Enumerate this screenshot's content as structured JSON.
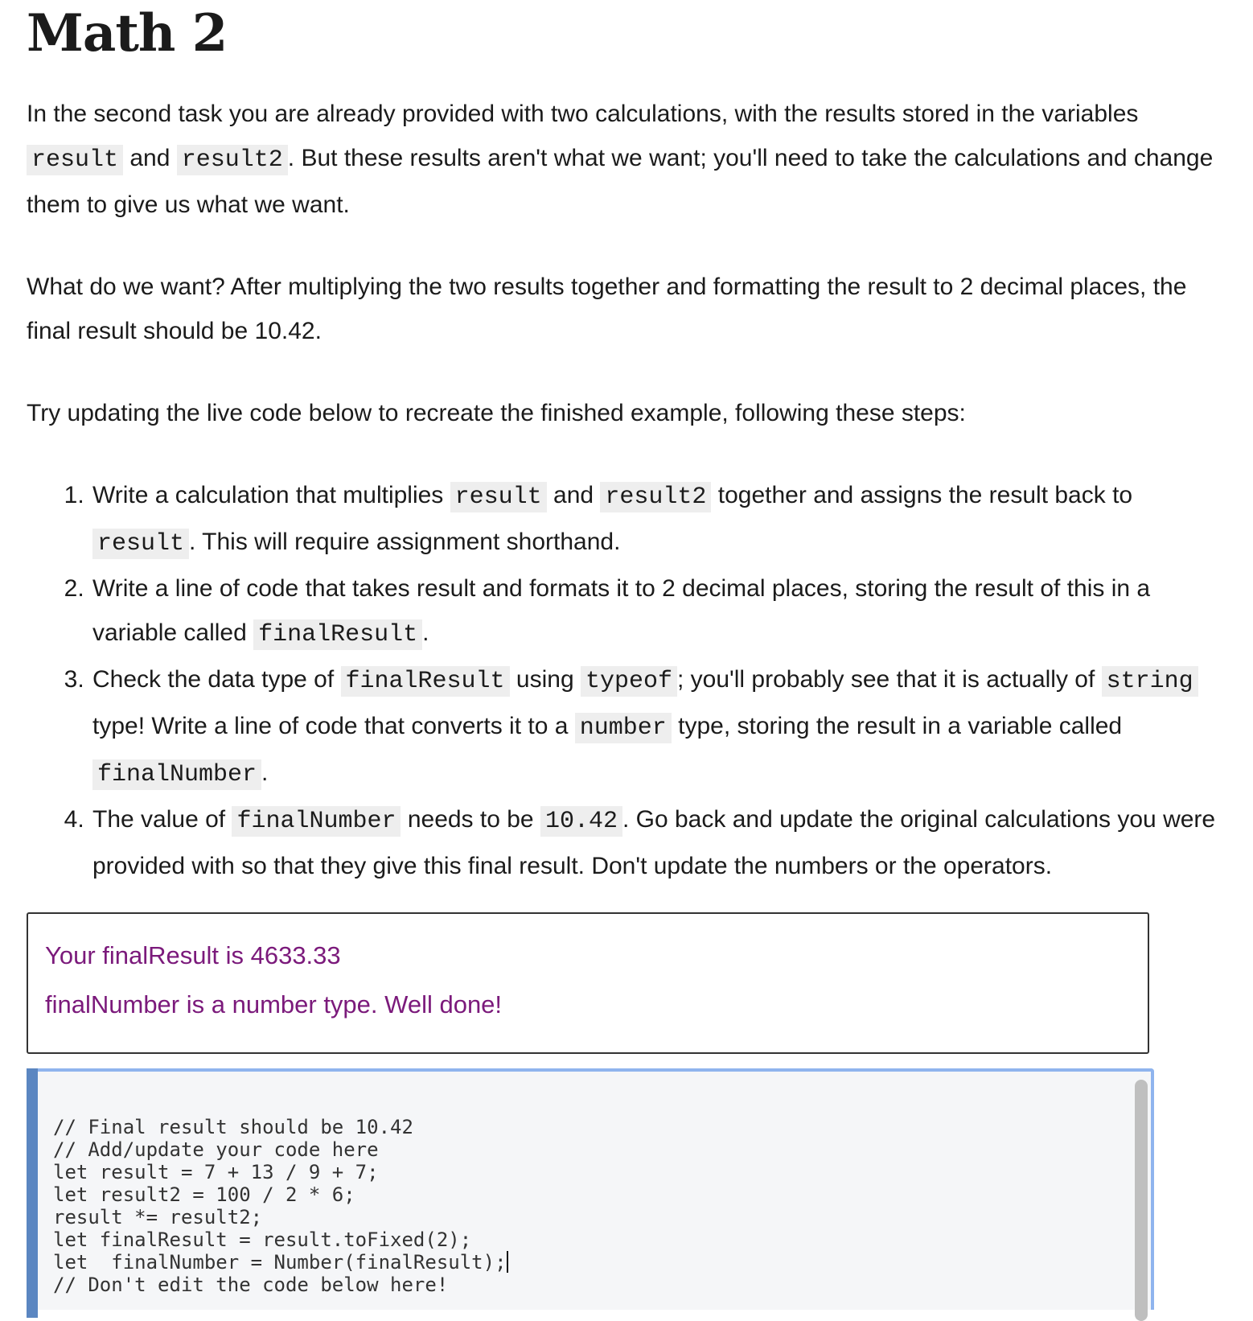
{
  "heading": "Math 2",
  "intro": {
    "t1": "In the second task you are already provided with two calculations, with the results stored in the variables ",
    "c1": "result",
    "t2": " and ",
    "c2": "result2",
    "t3": ". But these results aren't what we want; you'll need to take the calculations and change them to give us what we want."
  },
  "want_paragraph": "What do we want? After multiplying the two results together and formatting the result to 2 decimal places, the final result should be 10.42.",
  "try_paragraph": "Try updating the live code below to recreate the finished example, following these steps:",
  "steps": {
    "s1": {
      "t1": "Write a calculation that multiplies ",
      "c1": "result",
      "t2": " and ",
      "c2": "result2",
      "t3": " together and assigns the result back to ",
      "c3": "result",
      "t4": ". This will require assignment shorthand."
    },
    "s2": {
      "t1": "Write a line of code that takes result and formats it to 2 decimal places, storing the result of this in a variable called ",
      "c1": "finalResult",
      "t2": "."
    },
    "s3": {
      "t1": "Check the data type of ",
      "c1": "finalResult",
      "t2": " using ",
      "c2": "typeof",
      "t3": "; you'll probably see that it is actually of ",
      "c3": "string",
      "t4": " type! Write a line of code that converts it to a ",
      "c4": "number",
      "t5": " type, storing the result in a variable called ",
      "c5": "finalNumber",
      "t6": "."
    },
    "s4": {
      "t1": "The value of ",
      "c1": "finalNumber",
      "t2": " needs to be ",
      "c2": "10.42",
      "t3": ". Go back and update the original calculations you were provided with so that they give this final result. Don't update the numbers or the operators."
    }
  },
  "output": {
    "line1": "Your finalResult is 4633.33",
    "line2": "finalNumber is a number type. Well done!"
  },
  "code_lines": {
    "l1": "// Final result should be 10.42",
    "l2": "// Add/update your code here",
    "l3": "let result = 7 + 13 / 9 + 7;",
    "l4": "let result2 = 100 / 2 * 6;",
    "l5": "result *= result2;",
    "l6": "let finalResult = result.toFixed(2);",
    "l7": "let  finalNumber = Number(finalResult);",
    "l8": "// Don't edit the code below here!"
  },
  "colors": {
    "output_text": "#7b1a7b",
    "editor_border": "#8fb4ee",
    "editor_gutter": "#5b86c1",
    "editor_bg": "#f5f6f8",
    "inline_code_bg": "#eeeeee"
  }
}
